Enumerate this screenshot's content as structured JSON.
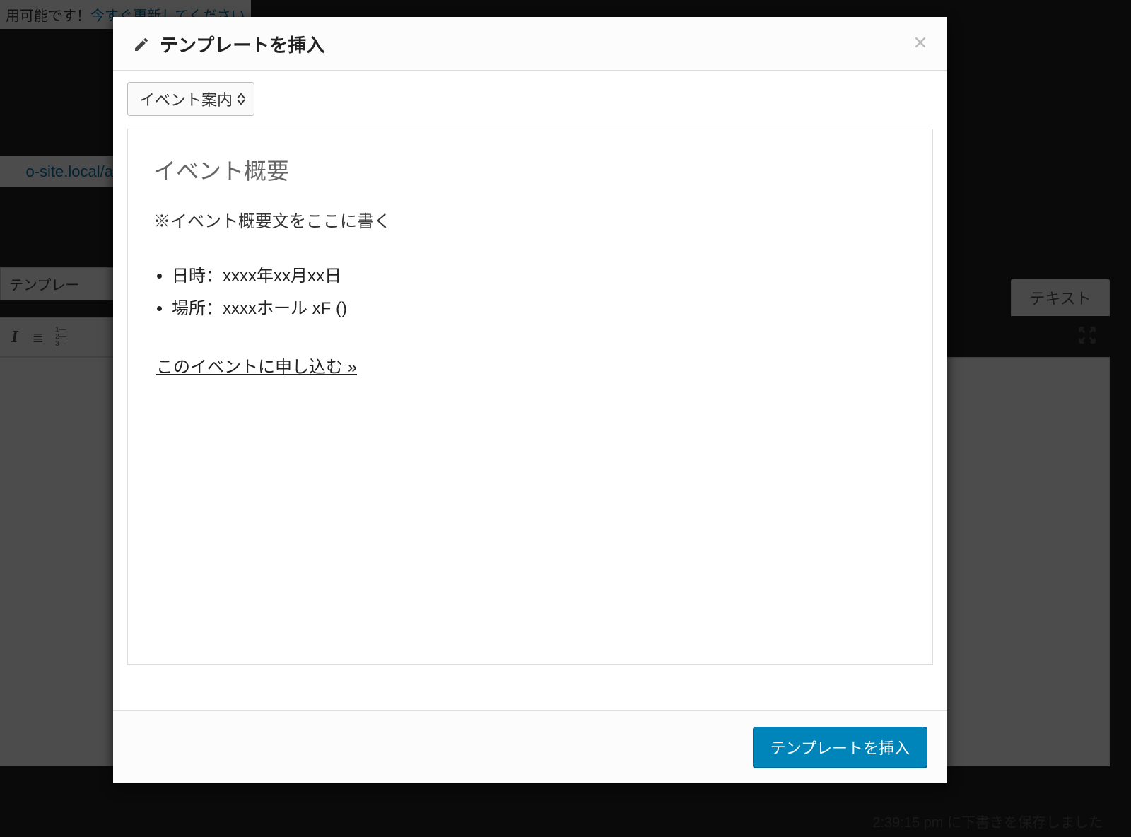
{
  "background": {
    "notice_prefix": "用可能です！",
    "notice_link": "今すぐ更新してください",
    "permalink_fragment": "o-site.local/a",
    "template_button": "テンプレー",
    "text_tab": "テキスト",
    "autosave": "2:39:15 pm に下書きを保存しました"
  },
  "modal": {
    "title": "テンプレートを挿入",
    "dropdown_selected": "イベント案内",
    "insert_button": "テンプレートを挿入"
  },
  "preview": {
    "heading": "イベント概要",
    "note": "※イベント概要文をここに書く",
    "items": [
      "日時：xxxx年xx月xx日",
      "場所：xxxxホール xF ()"
    ],
    "signup_link": "このイベントに申し込む »"
  }
}
